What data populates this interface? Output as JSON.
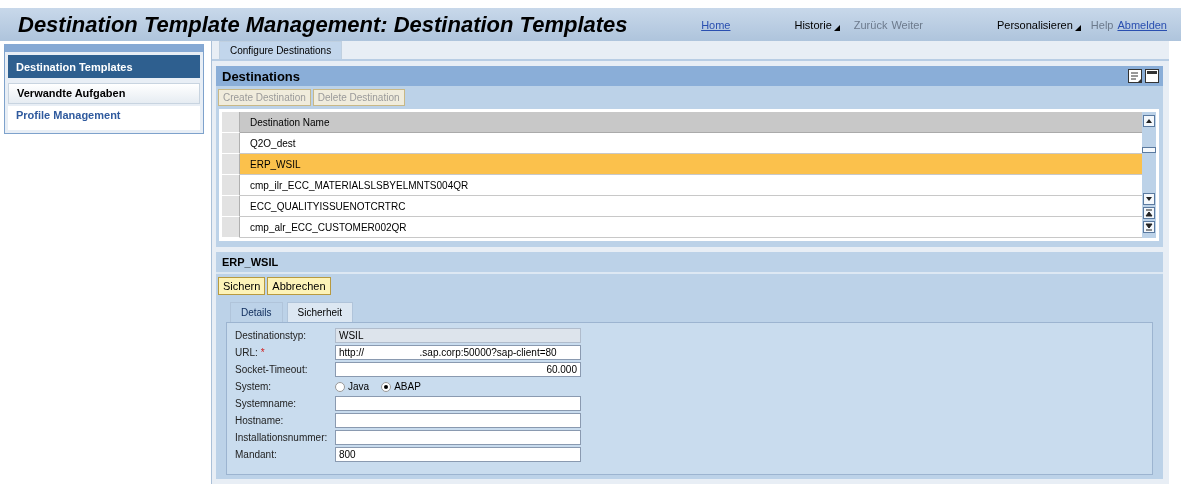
{
  "header": {
    "title": "Destination Template Management: Destination Templates",
    "links": [
      {
        "label": "Home",
        "kind": "link"
      },
      {
        "label": "Historie",
        "kind": "menu"
      },
      {
        "label": "Zurück",
        "kind": "disabled"
      },
      {
        "label": "Weiter",
        "kind": "disabled"
      },
      {
        "label": "Personalisieren",
        "kind": "menu"
      },
      {
        "label": "Help",
        "kind": "disabled"
      },
      {
        "label": "Abmelden",
        "kind": "link"
      }
    ]
  },
  "sidebar": {
    "items": [
      {
        "label": "Destination Templates",
        "kind": "header"
      },
      {
        "label": "Verwandte Aufgaben",
        "kind": "section"
      },
      {
        "label": "Profile Management",
        "kind": "link"
      }
    ]
  },
  "tabs": [
    {
      "label": "Configure Destinations",
      "selected": true
    }
  ],
  "destinations": {
    "title": "Destinations",
    "buttons": [
      {
        "label": "Create Destination",
        "disabled": true
      },
      {
        "label": "Delete Destination",
        "disabled": true
      }
    ],
    "column": "Destination Name",
    "rows": [
      {
        "name": "Q2O_dest",
        "selected": false
      },
      {
        "name": "ERP_WSIL",
        "selected": true
      },
      {
        "name": "cmp_ilr_ECC_MATERIALSLSBYELMNTS004QR",
        "selected": false
      },
      {
        "name": "ECC_QUALITYISSUENOTCRTRC",
        "selected": false
      },
      {
        "name": "cmp_alr_ECC_CUSTOMER002QR",
        "selected": false
      }
    ]
  },
  "detail": {
    "title": "ERP_WSIL",
    "buttons": [
      "Sichern",
      "Abbrechen"
    ],
    "tabs": [
      {
        "label": "Details",
        "selected": true
      },
      {
        "label": "Sicherheit",
        "selected": false
      }
    ],
    "fields": [
      {
        "label": "Destinationstyp:",
        "kind": "readonly",
        "value": "WSIL"
      },
      {
        "label": "URL:",
        "kind": "text",
        "required_mark": "*",
        "value": "http://                    .sap.corp:50000?sap-client=80"
      },
      {
        "label": "Socket-Timeout:",
        "kind": "number",
        "value": "60.000"
      },
      {
        "label": "System:",
        "kind": "radio",
        "options": [
          {
            "label": "Java",
            "selected": false
          },
          {
            "label": "ABAP",
            "selected": true
          }
        ]
      },
      {
        "label": "Systemname:",
        "kind": "text"
      },
      {
        "label": "Hostname:",
        "kind": "text"
      },
      {
        "label": "Installationsnummer:",
        "kind": "text"
      },
      {
        "label": "Mandant:",
        "kind": "text",
        "value": "800"
      }
    ]
  }
}
